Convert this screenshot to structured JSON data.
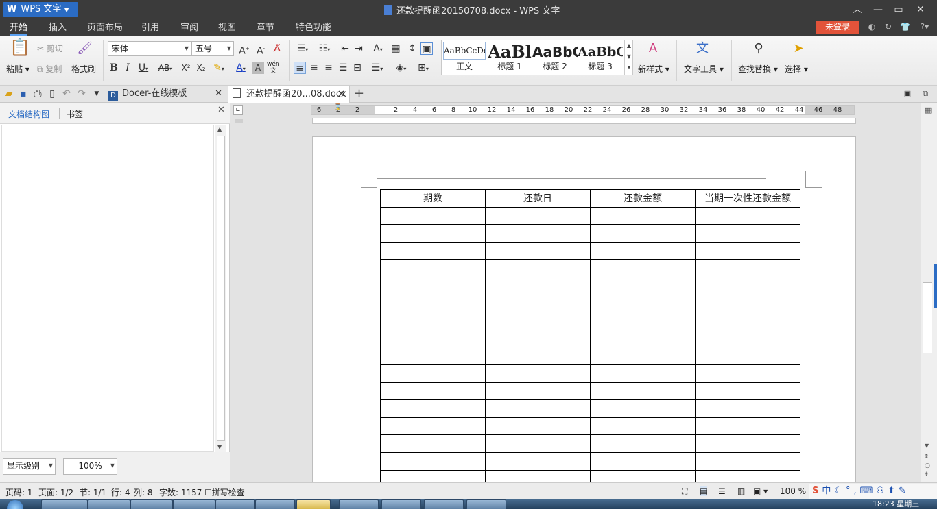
{
  "titlebar": {
    "app_button": "WPS 文字",
    "title": "还款提醒函20150708.docx - WPS 文字"
  },
  "menu": {
    "items": [
      "开始",
      "插入",
      "页面布局",
      "引用",
      "审阅",
      "视图",
      "章节",
      "特色功能"
    ],
    "login": "未登录"
  },
  "ribbon": {
    "paste": "粘贴",
    "cut": "剪切",
    "copy": "复制",
    "format_painter": "格式刷",
    "font_name": "宋体",
    "font_size": "五号",
    "phonetic": "wén",
    "styles": [
      {
        "sample": "AaBbCcDd",
        "name": "正文"
      },
      {
        "sample": "AaBl",
        "name": "标题 1"
      },
      {
        "sample": "AaBbC",
        "name": "标题 2"
      },
      {
        "sample": "AaBbC",
        "name": "标题 3"
      }
    ],
    "new_style": "新样式",
    "text_tools": "文字工具",
    "find_replace": "查找替换",
    "select": "选择"
  },
  "tabs": {
    "docer": "Docer-在线模板",
    "document": "还款提醒函20...08.docx",
    "add": "+"
  },
  "left_panel": {
    "tab_outline": "文档结构图",
    "tab_bookmark": "书签",
    "level_select": "显示级别",
    "zoom_select": "100%"
  },
  "ruler": {
    "ticks": [
      "6",
      "2",
      "2",
      "2",
      "4",
      "6",
      "8",
      "10",
      "12",
      "14",
      "16",
      "18",
      "20",
      "22",
      "24",
      "26",
      "28",
      "30",
      "32",
      "34",
      "36",
      "38",
      "40",
      "42",
      "44",
      "46",
      "48"
    ]
  },
  "table": {
    "headers": [
      "期数",
      "还款日",
      "还款金额",
      "当期一次性还款金额"
    ],
    "empty_rows": 16
  },
  "status": {
    "page_num": "页码: 1",
    "pages": "页面: 1/2",
    "section": "节: 1/1",
    "row": "行: 4",
    "col": "列: 8",
    "word_count": "字数: 1157",
    "spell_check": "拼写检查",
    "zoom": "100 %"
  },
  "taskbar": {
    "clock": "18:23 星期三"
  },
  "colors": {
    "accent": "#2b6cc4",
    "login": "#e2533a",
    "titlebar": "#3b3b3b"
  }
}
